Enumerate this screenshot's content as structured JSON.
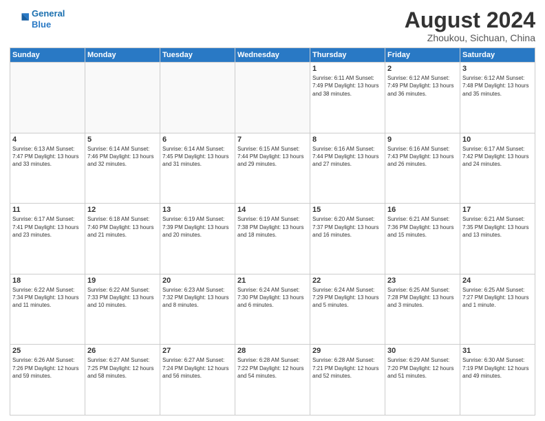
{
  "header": {
    "logo_line1": "General",
    "logo_line2": "Blue",
    "month": "August 2024",
    "location": "Zhoukou, Sichuan, China"
  },
  "weekdays": [
    "Sunday",
    "Monday",
    "Tuesday",
    "Wednesday",
    "Thursday",
    "Friday",
    "Saturday"
  ],
  "weeks": [
    [
      {
        "day": "",
        "info": ""
      },
      {
        "day": "",
        "info": ""
      },
      {
        "day": "",
        "info": ""
      },
      {
        "day": "",
        "info": ""
      },
      {
        "day": "1",
        "info": "Sunrise: 6:11 AM\nSunset: 7:49 PM\nDaylight: 13 hours\nand 38 minutes."
      },
      {
        "day": "2",
        "info": "Sunrise: 6:12 AM\nSunset: 7:49 PM\nDaylight: 13 hours\nand 36 minutes."
      },
      {
        "day": "3",
        "info": "Sunrise: 6:12 AM\nSunset: 7:48 PM\nDaylight: 13 hours\nand 35 minutes."
      }
    ],
    [
      {
        "day": "4",
        "info": "Sunrise: 6:13 AM\nSunset: 7:47 PM\nDaylight: 13 hours\nand 33 minutes."
      },
      {
        "day": "5",
        "info": "Sunrise: 6:14 AM\nSunset: 7:46 PM\nDaylight: 13 hours\nand 32 minutes."
      },
      {
        "day": "6",
        "info": "Sunrise: 6:14 AM\nSunset: 7:45 PM\nDaylight: 13 hours\nand 31 minutes."
      },
      {
        "day": "7",
        "info": "Sunrise: 6:15 AM\nSunset: 7:44 PM\nDaylight: 13 hours\nand 29 minutes."
      },
      {
        "day": "8",
        "info": "Sunrise: 6:16 AM\nSunset: 7:44 PM\nDaylight: 13 hours\nand 27 minutes."
      },
      {
        "day": "9",
        "info": "Sunrise: 6:16 AM\nSunset: 7:43 PM\nDaylight: 13 hours\nand 26 minutes."
      },
      {
        "day": "10",
        "info": "Sunrise: 6:17 AM\nSunset: 7:42 PM\nDaylight: 13 hours\nand 24 minutes."
      }
    ],
    [
      {
        "day": "11",
        "info": "Sunrise: 6:17 AM\nSunset: 7:41 PM\nDaylight: 13 hours\nand 23 minutes."
      },
      {
        "day": "12",
        "info": "Sunrise: 6:18 AM\nSunset: 7:40 PM\nDaylight: 13 hours\nand 21 minutes."
      },
      {
        "day": "13",
        "info": "Sunrise: 6:19 AM\nSunset: 7:39 PM\nDaylight: 13 hours\nand 20 minutes."
      },
      {
        "day": "14",
        "info": "Sunrise: 6:19 AM\nSunset: 7:38 PM\nDaylight: 13 hours\nand 18 minutes."
      },
      {
        "day": "15",
        "info": "Sunrise: 6:20 AM\nSunset: 7:37 PM\nDaylight: 13 hours\nand 16 minutes."
      },
      {
        "day": "16",
        "info": "Sunrise: 6:21 AM\nSunset: 7:36 PM\nDaylight: 13 hours\nand 15 minutes."
      },
      {
        "day": "17",
        "info": "Sunrise: 6:21 AM\nSunset: 7:35 PM\nDaylight: 13 hours\nand 13 minutes."
      }
    ],
    [
      {
        "day": "18",
        "info": "Sunrise: 6:22 AM\nSunset: 7:34 PM\nDaylight: 13 hours\nand 11 minutes."
      },
      {
        "day": "19",
        "info": "Sunrise: 6:22 AM\nSunset: 7:33 PM\nDaylight: 13 hours\nand 10 minutes."
      },
      {
        "day": "20",
        "info": "Sunrise: 6:23 AM\nSunset: 7:32 PM\nDaylight: 13 hours\nand 8 minutes."
      },
      {
        "day": "21",
        "info": "Sunrise: 6:24 AM\nSunset: 7:30 PM\nDaylight: 13 hours\nand 6 minutes."
      },
      {
        "day": "22",
        "info": "Sunrise: 6:24 AM\nSunset: 7:29 PM\nDaylight: 13 hours\nand 5 minutes."
      },
      {
        "day": "23",
        "info": "Sunrise: 6:25 AM\nSunset: 7:28 PM\nDaylight: 13 hours\nand 3 minutes."
      },
      {
        "day": "24",
        "info": "Sunrise: 6:25 AM\nSunset: 7:27 PM\nDaylight: 13 hours\nand 1 minute."
      }
    ],
    [
      {
        "day": "25",
        "info": "Sunrise: 6:26 AM\nSunset: 7:26 PM\nDaylight: 12 hours\nand 59 minutes."
      },
      {
        "day": "26",
        "info": "Sunrise: 6:27 AM\nSunset: 7:25 PM\nDaylight: 12 hours\nand 58 minutes."
      },
      {
        "day": "27",
        "info": "Sunrise: 6:27 AM\nSunset: 7:24 PM\nDaylight: 12 hours\nand 56 minutes."
      },
      {
        "day": "28",
        "info": "Sunrise: 6:28 AM\nSunset: 7:22 PM\nDaylight: 12 hours\nand 54 minutes."
      },
      {
        "day": "29",
        "info": "Sunrise: 6:28 AM\nSunset: 7:21 PM\nDaylight: 12 hours\nand 52 minutes."
      },
      {
        "day": "30",
        "info": "Sunrise: 6:29 AM\nSunset: 7:20 PM\nDaylight: 12 hours\nand 51 minutes."
      },
      {
        "day": "31",
        "info": "Sunrise: 6:30 AM\nSunset: 7:19 PM\nDaylight: 12 hours\nand 49 minutes."
      }
    ]
  ]
}
